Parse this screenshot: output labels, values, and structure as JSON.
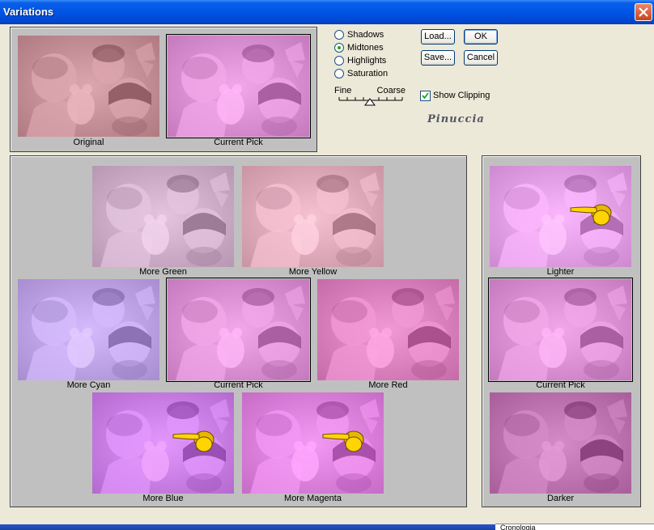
{
  "window": {
    "title": "Variations"
  },
  "options": {
    "ranges": [
      {
        "label": "Shadows",
        "checked": false
      },
      {
        "label": "Midtones",
        "checked": true
      },
      {
        "label": "Highlights",
        "checked": false
      },
      {
        "label": "Saturation",
        "checked": false
      }
    ],
    "slider": {
      "fine_label": "Fine",
      "coarse_label": "Coarse"
    },
    "show_clipping": {
      "label": "Show Clipping",
      "checked": true
    },
    "watermark": "Pinuccia"
  },
  "buttons": {
    "load": "Load...",
    "ok": "OK",
    "save": "Save...",
    "cancel": "Cancel"
  },
  "compare": {
    "original": "Original",
    "current": "Current Pick"
  },
  "hue": {
    "more_green": "More Green",
    "more_yellow": "More Yellow",
    "more_cyan": "More Cyan",
    "current": "Current Pick",
    "more_red": "More Red",
    "more_blue": "More Blue",
    "more_magenta": "More Magenta"
  },
  "brightness": {
    "lighter": "Lighter",
    "current": "Current Pick",
    "darker": "Darker"
  },
  "taskbar": {
    "right_text": "Cronologia"
  },
  "colors": {
    "original": "#B07A82",
    "current": "#C47ABC",
    "more_green": "#B797B2",
    "more_yellow": "#C995A5",
    "more_cyan": "#A88ED0",
    "more_red": "#C56CA8",
    "more_blue": "#B56AD0",
    "more_magenta": "#C66CC7",
    "lighter": "#CE8AD0",
    "darker": "#A85E9B"
  }
}
